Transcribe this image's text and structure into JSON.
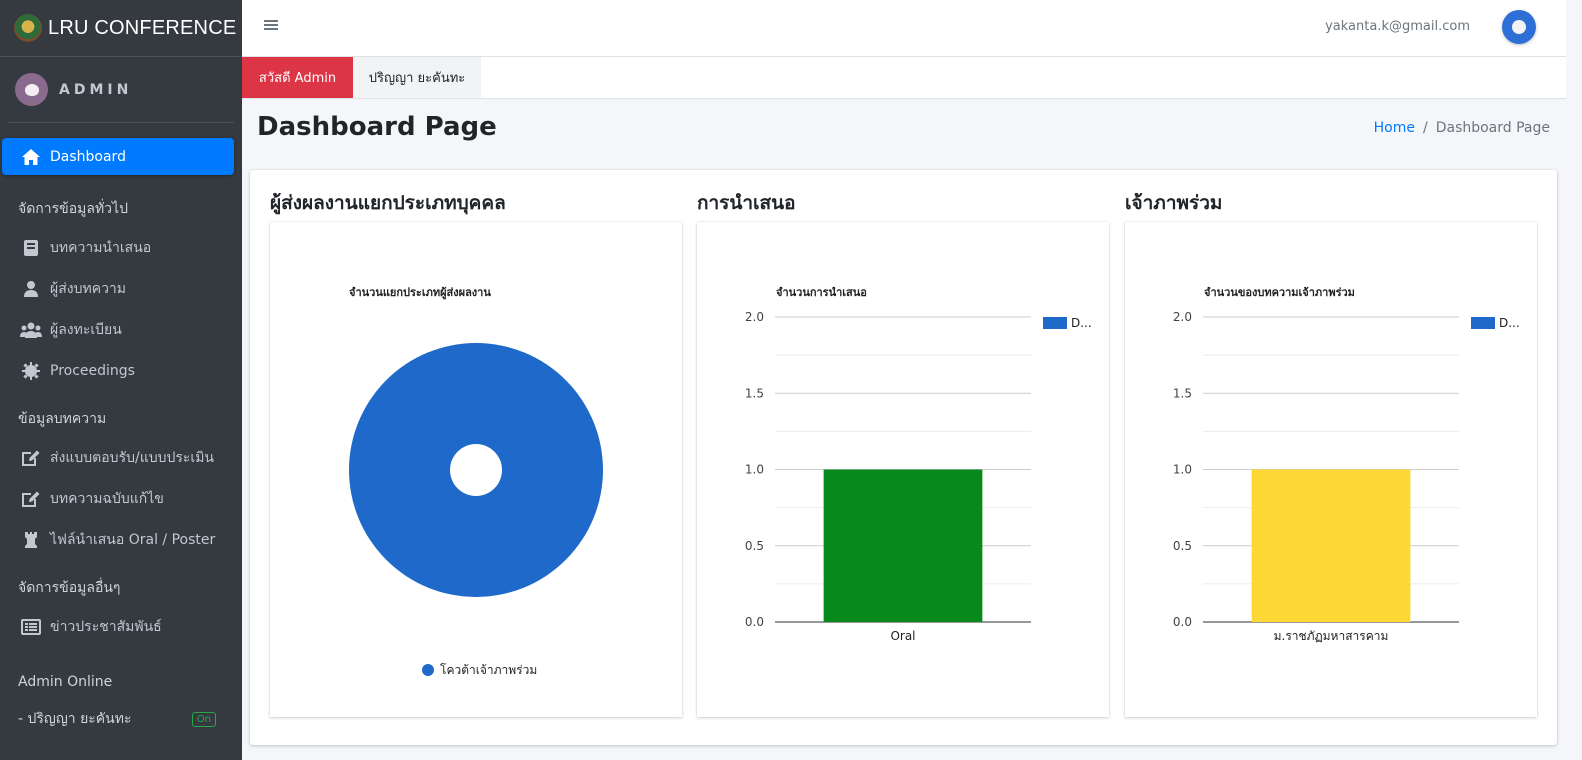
{
  "app": {
    "title": "LRU CONFERENCE"
  },
  "user_panel": {
    "name": "ADMIN"
  },
  "sidebar": {
    "active": {
      "label": "Dashboard",
      "icon": "home-icon"
    },
    "sections": [
      {
        "header": "จัดการข้อมูลทั่วไป",
        "items": [
          {
            "label": "บทความนำเสนอ",
            "icon": "book-icon"
          },
          {
            "label": "ผู้ส่งบทความ",
            "icon": "user-icon"
          },
          {
            "label": "ผู้ลงทะเบียน",
            "icon": "users-icon"
          },
          {
            "label": "Proceedings",
            "icon": "gear-icon"
          }
        ]
      },
      {
        "header": "ข้อมูลบทความ",
        "items": [
          {
            "label": "ส่งแบบตอบรับ/แบบประเมิน",
            "icon": "edit-icon"
          },
          {
            "label": "บทความฉบับแก้ไข",
            "icon": "edit-icon"
          },
          {
            "label": "ไฟล์นำเสนอ Oral / Poster",
            "icon": "chess-rook-icon"
          }
        ]
      },
      {
        "header": "จัดการข้อมูลอื่นๆ",
        "items": [
          {
            "label": "ข่าวประชาสัมพันธ์",
            "icon": "list-icon"
          }
        ]
      }
    ],
    "online": {
      "header": "Admin Online",
      "user": "- ปริญญา ยะคันทะ",
      "badge": "On"
    }
  },
  "navbar": {
    "email": "yakanta.k@gmail.com",
    "menu_icon": "hamburger-icon",
    "avatar_icon": "user-avatar-icon"
  },
  "tabs": [
    {
      "label": "สวัสดี Admin",
      "color": "#dc3545"
    },
    {
      "label": "ปริญญา ยะคันทะ"
    }
  ],
  "page": {
    "title": "Dashboard Page"
  },
  "breadcrumb": {
    "home": "Home",
    "sep": "/",
    "current": "Dashboard Page"
  },
  "panels": [
    {
      "title": "ผู้ส่งผลงานแยกประเภทบุคคล"
    },
    {
      "title": "การนำเสนอ"
    },
    {
      "title": "เจ้าภาพร่วม"
    }
  ],
  "chart_data": [
    {
      "type": "pie",
      "title": "จำนวนแยกประเภทผู้ส่งผลงาน",
      "categories": [
        "โควต้าเจ้าภาพร่วม"
      ],
      "values": [
        1
      ],
      "colors": [
        "#1e69c9"
      ],
      "legend": "bottom"
    },
    {
      "type": "bar",
      "title": "จำนวนการนำเสนอ",
      "categories": [
        "Oral"
      ],
      "series": [
        {
          "name": "D...",
          "values": [
            1
          ]
        }
      ],
      "bar_colors": [
        "#08891c"
      ],
      "legend_color": "#1e69c9",
      "ylim": [
        0,
        2
      ],
      "yticks": [
        "0.0",
        "0.5",
        "1.0",
        "1.5",
        "2.0"
      ],
      "grid": true,
      "legend": "top-right"
    },
    {
      "type": "bar",
      "title": "จำนวนของบทความเจ้าภาพร่วม",
      "categories": [
        "ม.ราชภัฏมหาสารคาม"
      ],
      "series": [
        {
          "name": "D...",
          "values": [
            1
          ]
        }
      ],
      "bar_colors": [
        "#fdd835"
      ],
      "legend_color": "#1e69c9",
      "ylim": [
        0,
        2
      ],
      "yticks": [
        "0.0",
        "0.5",
        "1.0",
        "1.5",
        "2.0"
      ],
      "grid": true,
      "legend": "top-right"
    }
  ]
}
